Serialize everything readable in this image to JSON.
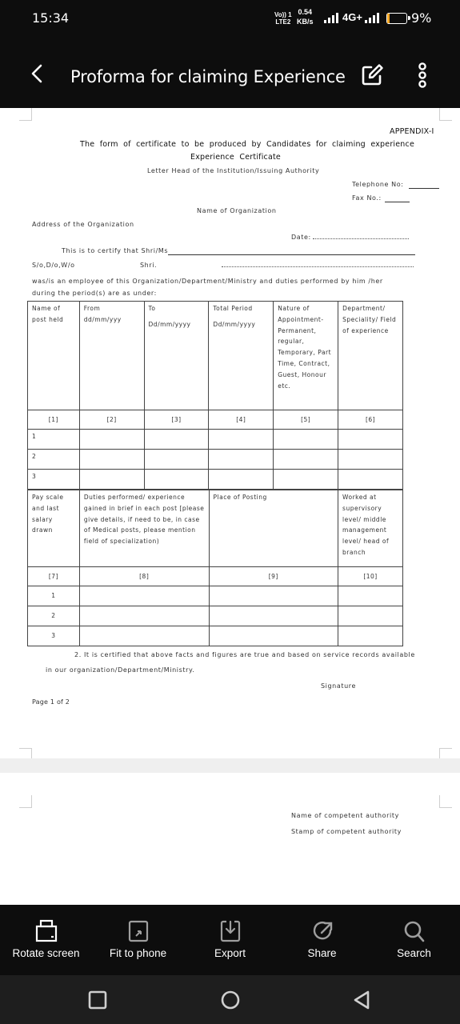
{
  "status": {
    "time": "15:34",
    "volte_top": "Vo)) 1",
    "volte_bottom": "LTE2",
    "speed_value": "0.54",
    "speed_unit": "KB/s",
    "network": "4G+",
    "battery": "9%",
    "battery_level": 0.09,
    "battery_color": "#f5a623"
  },
  "appbar": {
    "title": "Proforma for claiming Experience",
    "icons": [
      "back-arrow-icon",
      "edit-icon",
      "more-vert-icon"
    ]
  },
  "document": {
    "appendix": "APPENDIX-I",
    "heading_line1": "The  form  of  certificate  to  be  produced  by  Candidates  for  claiming  experience",
    "heading_line2": "Experience  Certificate",
    "letterhead": "Letter Head of the Institution/Issuing Authority",
    "telephone": "Telephone No:",
    "fax": "Fax No.:",
    "org_name": "Name of Organization",
    "address": "Address of the Organization",
    "date": "Date:",
    "certify": "This is to certify that Shri/Ms",
    "sdw": "S/o,D/o,W/o",
    "shri": "Shri.",
    "employee_line1": "was/is an employee of this Organization/Department/Ministry and duties performed by him /her",
    "employee_line2": "during the period(s) are as under:",
    "table1": {
      "headers": [
        "Name of post held",
        "From dd/mm/yyy",
        "To Dd/mm/yyyy",
        "Total Period Dd/mm/yyyy",
        "Nature of Appointment- Permanent, regular, Temporary, Part Time, Contract, Guest, Honour etc.",
        "Department/ Speciality/ Field of experience"
      ],
      "h1a": "Name of",
      "h1b": "post held",
      "h2a": "From",
      "h2b": "dd/mm/yyy",
      "h3a": "To",
      "h3b": "Dd/mm/yyyy",
      "h4a": "Total Period",
      "h4b": "Dd/mm/yyyy",
      "h5": "Nature of Appointment- Permanent, regular, Temporary, Part Time, Contract, Guest, Honour etc.",
      "h6": "Department/ Speciality/ Field of experience",
      "numbers": [
        "[1]",
        "[2]",
        "[3]",
        "[4]",
        "[5]",
        "[6]"
      ],
      "rows": [
        "1",
        "2",
        "3"
      ]
    },
    "table2": {
      "h7": "Pay scale and last salary drawn",
      "h8": "Duties performed/ experience gained in brief in each post [please give details, if need to be, in case of Medical posts, please mention field of specialization)",
      "h9": "Place of Posting",
      "h10": "Worked at supervisory level/ middle management level/ head of branch",
      "numbers": [
        "[7]",
        "[8]",
        "[9]",
        "[10]"
      ],
      "rows": [
        "1",
        "2",
        "3"
      ]
    },
    "certified_line1": "2. It is certified that above facts and figures are true and based on service records available",
    "certified_line2": "in our organization/Department/Ministry.",
    "signature": "Signature",
    "page_label": "Page 1 of 2",
    "competent_name": "Name of competent authority",
    "competent_stamp": "Stamp of competent authority"
  },
  "toolbar": {
    "rotate": "Rotate screen",
    "fit": "Fit to phone",
    "export": "Export",
    "share": "Share",
    "search": "Search"
  },
  "navbar": {
    "buttons": [
      "recents-square-icon",
      "home-circle-icon",
      "back-triangle-icon"
    ]
  }
}
